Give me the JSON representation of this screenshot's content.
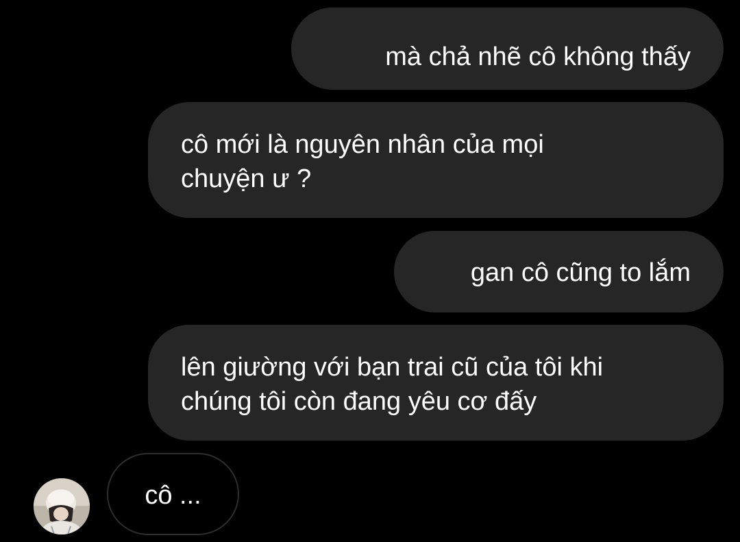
{
  "messages": [
    {
      "sender": "other",
      "text": "mà chả nhẽ cô không thấy"
    },
    {
      "sender": "other",
      "lines": [
        "cô mới là nguyên nhân của mọi",
        "chuyện ư ?"
      ]
    },
    {
      "sender": "other",
      "text": "gan cô cũng to lắm"
    },
    {
      "sender": "other",
      "lines": [
        "lên giường với bạn trai cũ của tôi khi",
        "chúng tôi còn đang yêu cơ đấy"
      ]
    },
    {
      "sender": "me",
      "text": "cô ...",
      "has_avatar": true
    }
  ],
  "colors": {
    "background": "#000000",
    "bubble": "#262626",
    "outlined_bubble_border": "#2e2e2e",
    "text": "#ffffff"
  }
}
